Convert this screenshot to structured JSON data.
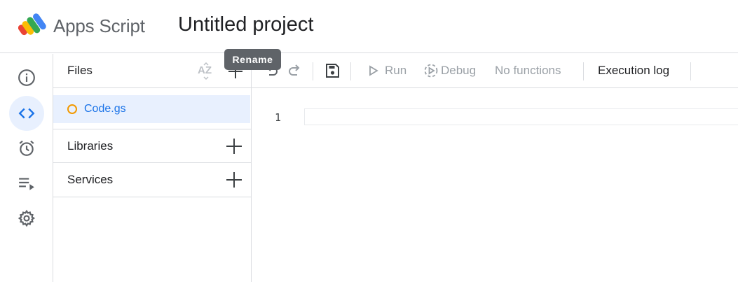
{
  "header": {
    "app_name": "Apps Script",
    "project_title": "Untitled project",
    "logo_icon": "apps-script-logo"
  },
  "rail": {
    "items": [
      {
        "name": "overview",
        "icon": "info-icon",
        "active": false
      },
      {
        "name": "editor",
        "icon": "code-icon",
        "active": true
      },
      {
        "name": "triggers",
        "icon": "alarm-clock-icon",
        "active": false
      },
      {
        "name": "executions",
        "icon": "executions-list-icon",
        "active": false
      },
      {
        "name": "settings",
        "icon": "gear-icon",
        "active": false
      }
    ]
  },
  "files_panel": {
    "files_label": "Files",
    "sort_icon": "sort-az-icon",
    "add_icon": "plus-icon",
    "files": [
      {
        "name": "Code.gs",
        "selected": true
      }
    ],
    "libraries_label": "Libraries",
    "services_label": "Services"
  },
  "toolbar": {
    "run_label": "Run",
    "debug_label": "Debug",
    "function_select": "No functions",
    "execution_log_label": "Execution log"
  },
  "editor": {
    "line_numbers": [
      "1"
    ]
  },
  "tooltip": {
    "text": "Rename"
  },
  "colors": {
    "accent": "#1a73e8",
    "active_bg": "#e8f0fe",
    "file_dot": "#f29900",
    "divider": "#dadce0",
    "disabled_text": "#9aa0a6"
  }
}
